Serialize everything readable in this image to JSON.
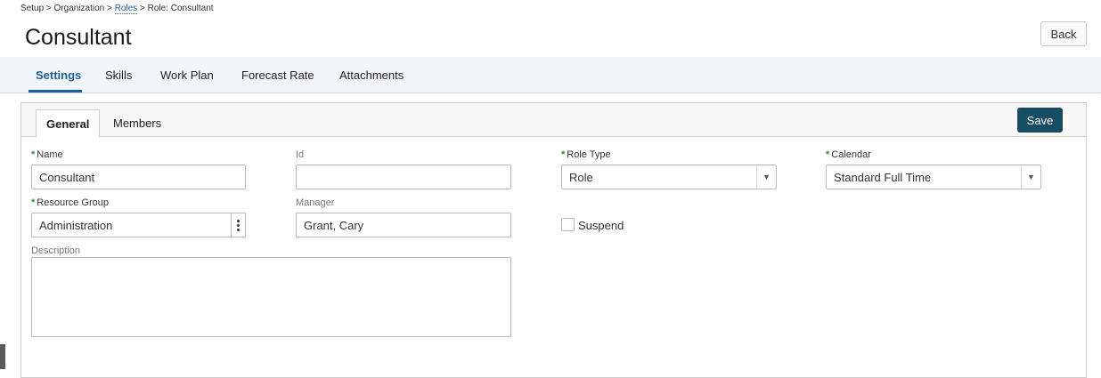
{
  "breadcrumb": {
    "part1": "Setup > Organization >",
    "roles_link": "Roles",
    "part2": "> Role: Consultant"
  },
  "page": {
    "title": "Consultant",
    "back_label": "Back"
  },
  "tabs": [
    {
      "label": "Settings",
      "active": true
    },
    {
      "label": "Skills"
    },
    {
      "label": "Work Plan"
    },
    {
      "label": "Forecast Rate"
    },
    {
      "label": "Attachments"
    }
  ],
  "subtabs": [
    {
      "label": "General",
      "active": true
    },
    {
      "label": "Members"
    }
  ],
  "save_label": "Save",
  "form": {
    "required_marker": "*",
    "name": {
      "label": "Name",
      "value": "Consultant",
      "required": true
    },
    "id": {
      "label": "Id",
      "value": ""
    },
    "role_type": {
      "label": "Role Type",
      "value": "Role",
      "required": true
    },
    "calendar": {
      "label": "Calendar",
      "value": "Standard Full Time",
      "required": true
    },
    "resource_group": {
      "label": "Resource Group",
      "value": "Administration",
      "required": true
    },
    "manager": {
      "label": "Manager",
      "value": "Grant, Cary"
    },
    "suspend": {
      "label": "Suspend",
      "checked": false
    },
    "description": {
      "label": "Description",
      "value": ""
    }
  },
  "icons": {
    "dropdown": "chevron-down-icon",
    "more": "kebab-icon"
  },
  "colors": {
    "accent": "#1f5e9e",
    "save_button": "#174d63",
    "required": "#2e8b3a",
    "tabbar_bg": "#f0f6fa"
  }
}
